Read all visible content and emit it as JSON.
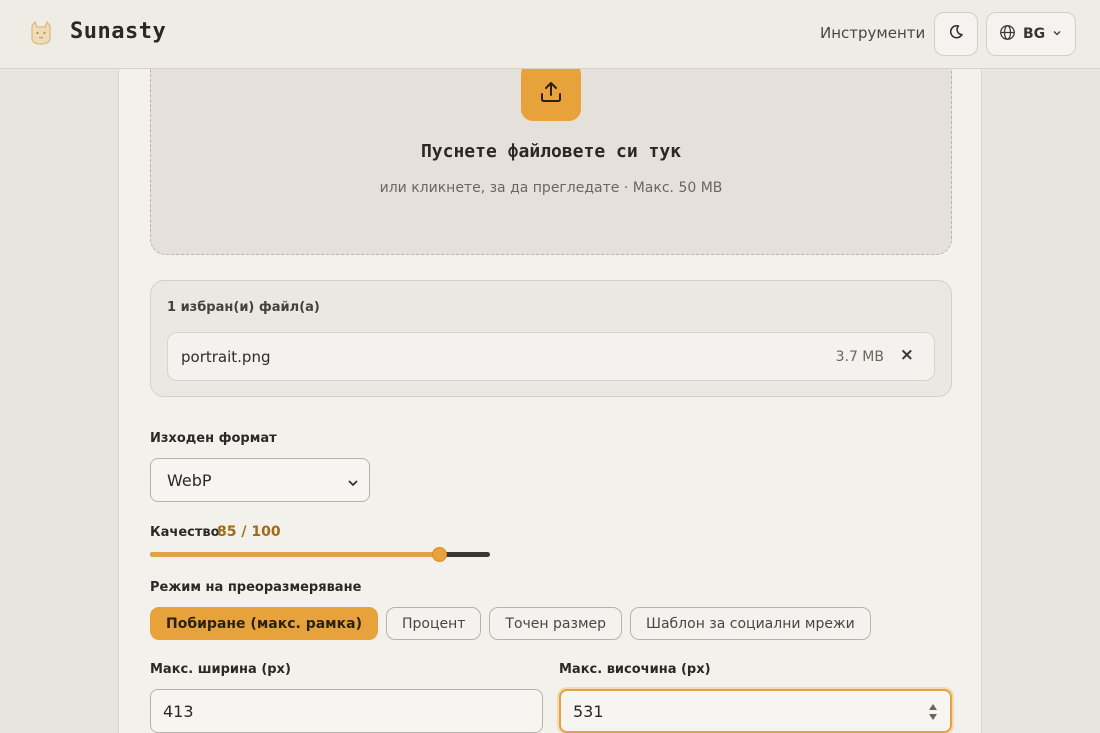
{
  "header": {
    "brand": "Sunasty",
    "nav_tools": "Инструменти",
    "language": "BG",
    "icons": {
      "logo": "cat-logo-icon",
      "theme": "moon-icon",
      "language": "globe-icon",
      "dropdown": "chevron-down-icon"
    }
  },
  "dropzone": {
    "title": "Пуснете файловете си тук",
    "subtitle": "или кликнете, за да прегледате · Макс. 50 MB",
    "icon": "upload-icon"
  },
  "files": {
    "count_label": "1 избран(и) файл(а)",
    "items": [
      {
        "name": "portrait.png",
        "size": "3.7 MB",
        "remove": "×"
      }
    ]
  },
  "output_format": {
    "label": "Изходен формат",
    "selected": "WebP"
  },
  "quality": {
    "label": "Качество",
    "display": "85 / 100",
    "value": 85,
    "max": 100
  },
  "resize": {
    "label": "Режим на преоразмеряване",
    "modes": [
      {
        "label": "Побиране (макс. рамка)",
        "active": true
      },
      {
        "label": "Процент",
        "active": false
      },
      {
        "label": "Точен размер",
        "active": false
      },
      {
        "label": "Шаблон за социални мрежи",
        "active": false
      }
    ]
  },
  "dimensions": {
    "width_label": "Макс. ширина (px)",
    "width_value": "413",
    "height_label": "Макс. височина (px)",
    "height_value": "531"
  },
  "colors": {
    "accent": "#e8a23b",
    "background": "#e8e5df",
    "card": "#f3f1ec"
  }
}
